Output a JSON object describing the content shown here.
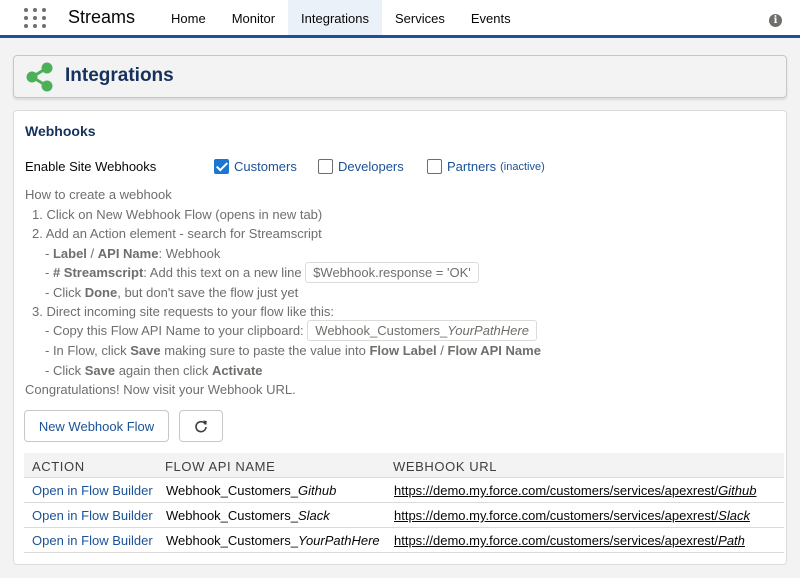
{
  "app": {
    "name": "Streams"
  },
  "nav": {
    "tabs": [
      {
        "label": "Home"
      },
      {
        "label": "Monitor"
      },
      {
        "label": "Integrations",
        "active": true
      },
      {
        "label": "Services"
      },
      {
        "label": "Events"
      }
    ]
  },
  "page": {
    "title": "Integrations",
    "accent_color": "#4bb057"
  },
  "webhooks": {
    "title": "Webhooks",
    "enable_label": "Enable Site Webhooks",
    "sites": [
      {
        "label": "Customers",
        "checked": true,
        "status": ""
      },
      {
        "label": "Developers",
        "checked": false,
        "status": ""
      },
      {
        "label": "Partners",
        "checked": false,
        "status": "(inactive)"
      }
    ]
  },
  "instructions": {
    "heading": "How to create a webhook",
    "step1": "1. Click on New Webhook Flow (opens in new tab)",
    "step2": "2. Add an Action element - search for Streamscript",
    "s2a_bold1": "Label",
    "s2a_sep": " / ",
    "s2a_bold2": "API Name",
    "s2a_rest": ": Webhook",
    "s2b_bold": "# Streamscript",
    "s2b_rest": ": Add this text on a new line",
    "s2b_code": "$Webhook.response = 'OK'",
    "s2c_pre": "- Click ",
    "s2c_bold": "Done",
    "s2c_rest": ", but don't save the flow just yet",
    "step3": "3. Direct incoming site requests to your flow like this:",
    "s3a_text": "- Copy this Flow API Name to your clipboard:",
    "s3a_code_prefix": "Webhook_Customers_",
    "s3a_code_italic": "YourPathHere",
    "s3b_pre": "- In Flow, click ",
    "s3b_bold1": "Save",
    "s3b_mid": " making sure to paste the value into ",
    "s3b_bold2": "Flow Label",
    "s3b_sep": " / ",
    "s3b_bold3": "Flow API Name",
    "s3c_pre": "- Click ",
    "s3c_bold1": "Save",
    "s3c_mid": " again then click ",
    "s3c_bold2": "Activate",
    "footer": "Congratulations! Now visit your Webhook URL."
  },
  "buttons": {
    "new_flow": "New Webhook Flow",
    "refresh_icon": "refresh-icon"
  },
  "table": {
    "headers": [
      "ACTION",
      "FLOW API NAME",
      "WEBHOOK URL"
    ],
    "rows": [
      {
        "action": "Open in Flow Builder",
        "name_prefix": "Webhook_Customers_",
        "name_italic": "Github",
        "url_prefix": "https://demo.my.force.com/customers/services/apexrest/",
        "url_italic": "Github"
      },
      {
        "action": "Open in Flow Builder",
        "name_prefix": "Webhook_Customers_",
        "name_italic": "Slack",
        "url_prefix": "https://demo.my.force.com/customers/services/apexrest/",
        "url_italic": "Slack"
      },
      {
        "action": "Open in Flow Builder",
        "name_prefix": "Webhook_Customers_",
        "name_italic": "YourPathHere",
        "url_prefix": "https://demo.my.force.com/customers/services/apexrest/",
        "url_italic": "Path"
      }
    ]
  }
}
